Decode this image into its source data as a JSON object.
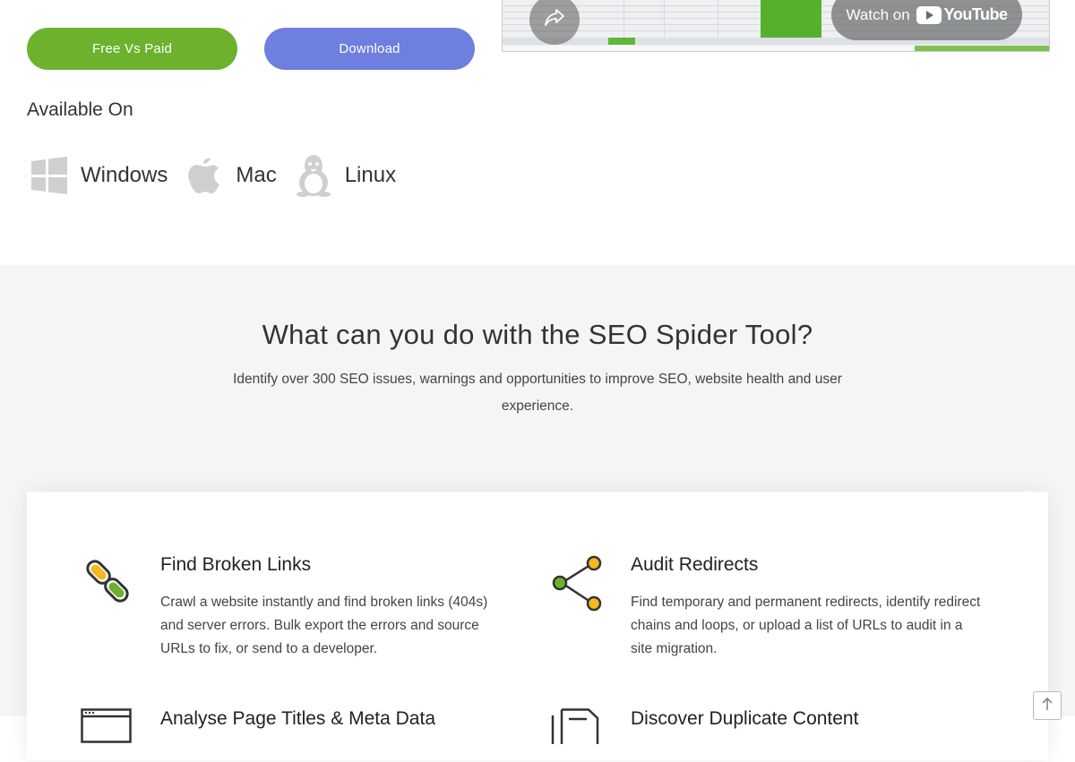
{
  "buttons": {
    "free_vs_paid": "Free Vs Paid",
    "download": "Download"
  },
  "available": {
    "title": "Available On",
    "platforms": [
      {
        "label": "Windows",
        "icon": "windows-icon"
      },
      {
        "label": "Mac",
        "icon": "apple-icon"
      },
      {
        "label": "Linux",
        "icon": "linux-icon"
      }
    ]
  },
  "video": {
    "watch_label": "Watch on",
    "youtube_word": "YouTube",
    "share_icon": "share-icon"
  },
  "section": {
    "title": "What can you do with the SEO Spider Tool?",
    "subtitle": "Identify over 300 SEO issues, warnings and opportunities to improve SEO, website health and user experience."
  },
  "features": [
    {
      "icon": "broken-link-icon",
      "title": "Find Broken Links",
      "text": "Crawl a website instantly and find broken links (404s) and server errors. Bulk export the errors and source URLs to fix, or send to a developer."
    },
    {
      "icon": "redirect-icon",
      "title": "Audit Redirects",
      "text": "Find temporary and permanent redirects, identify redirect chains and loops, or upload a list of URLs to audit in a site migration."
    },
    {
      "icon": "browser-window-icon",
      "title": "Analyse Page Titles & Meta Data",
      "text": ""
    },
    {
      "icon": "duplicate-document-icon",
      "title": "Discover Duplicate Content",
      "text": ""
    }
  ],
  "colors": {
    "green": "#6cb22d",
    "blue": "#6e7fe0",
    "orange": "#f5b81f",
    "section_bg": "#f5f5f5"
  }
}
